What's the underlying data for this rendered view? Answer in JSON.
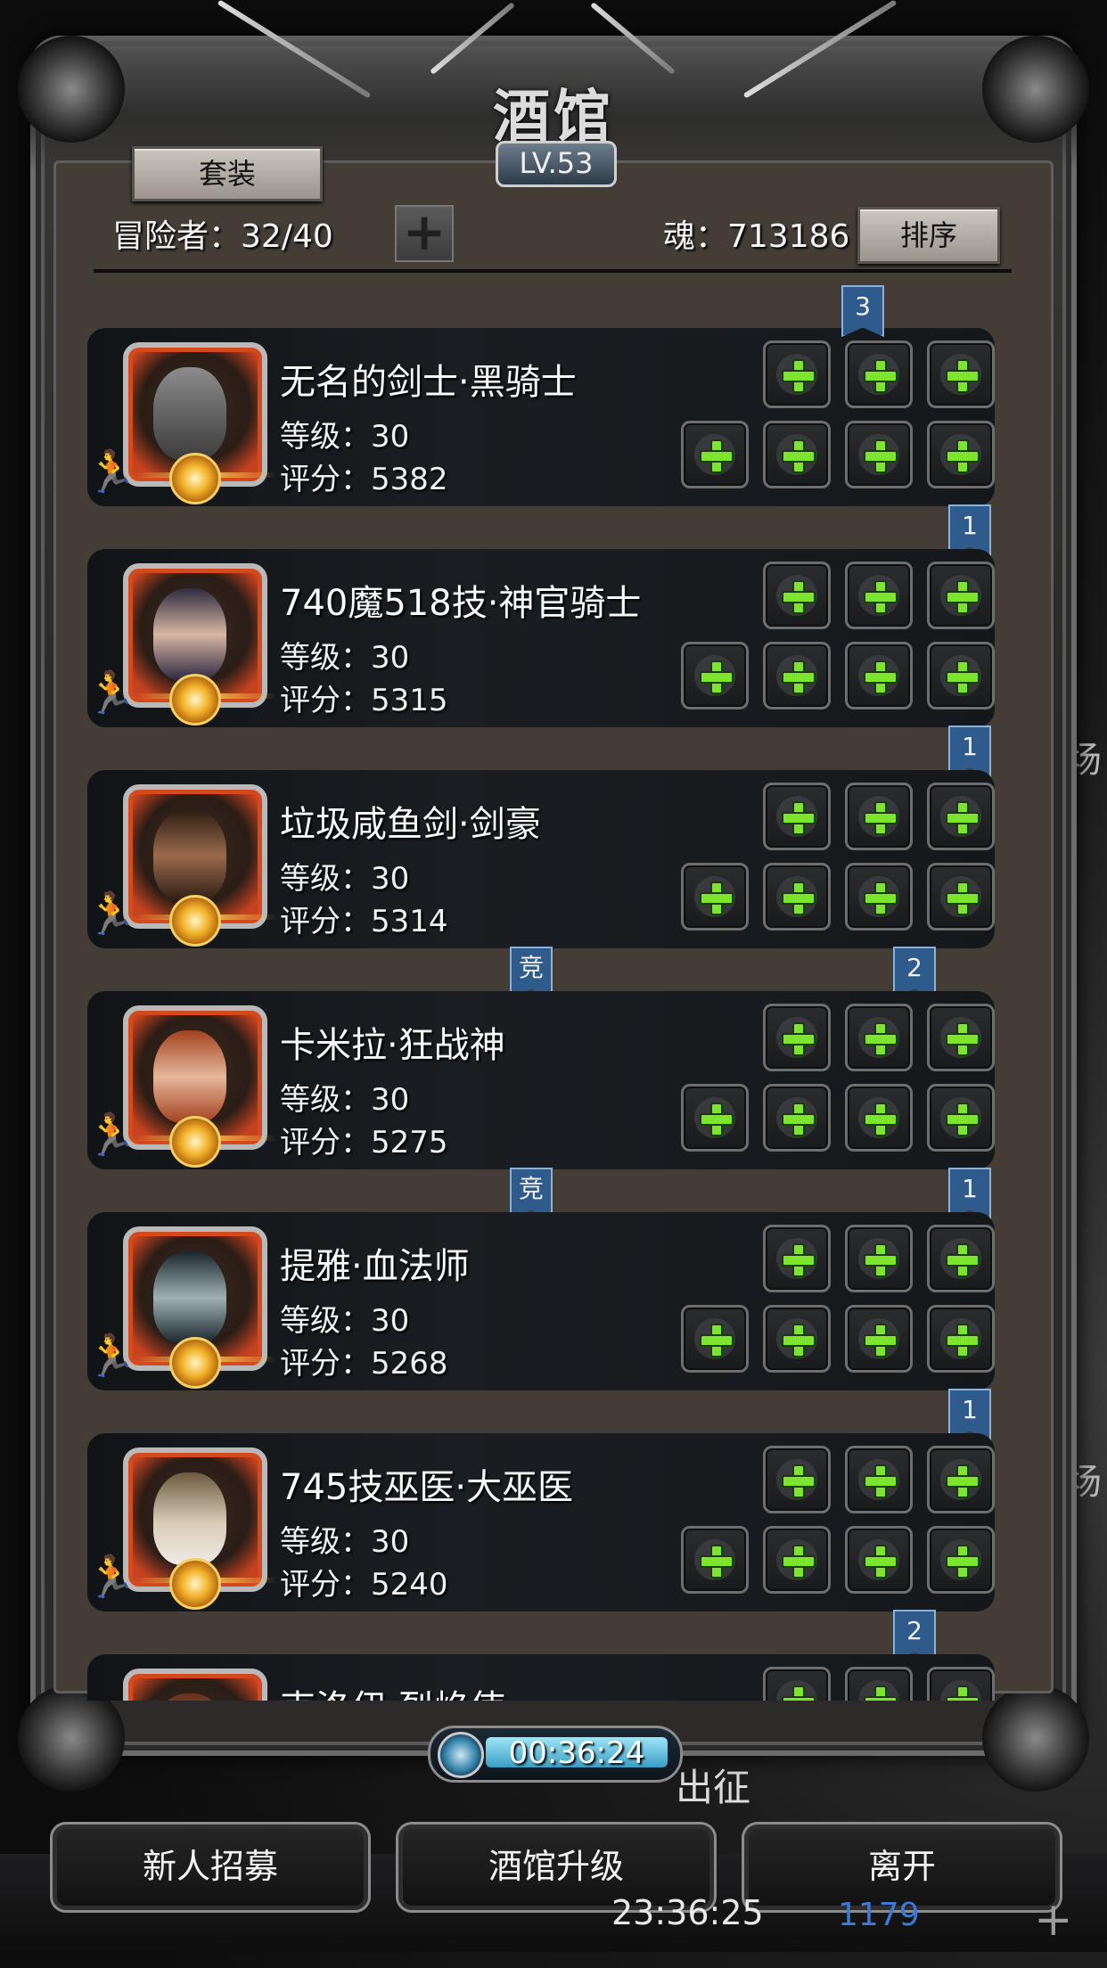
{
  "title": "酒馆",
  "level": "LV.53",
  "header": {
    "suit_button": "套装",
    "adventurers_label": "冒险者：32/40",
    "soul_label": "魂：713186",
    "sort_button": "排序"
  },
  "heroes": [
    {
      "name": "无名的剑士·黑骑士",
      "level": "等级：30",
      "score": "评分：5382",
      "ribbon_right": "3",
      "ribbon_left": ""
    },
    {
      "name": "740魔518技·神官骑士",
      "level": "等级：30",
      "score": "评分：5315",
      "ribbon_right": "1",
      "ribbon_left": ""
    },
    {
      "name": "垃圾咸鱼剑·剑豪",
      "level": "等级：30",
      "score": "评分：5314",
      "ribbon_right": "1",
      "ribbon_left": ""
    },
    {
      "name": "卡米拉·狂战神",
      "level": "等级：30",
      "score": "评分：5275",
      "ribbon_right": "2",
      "ribbon_left": "竞"
    },
    {
      "name": "提雅·血法师",
      "level": "等级：30",
      "score": "评分：5268",
      "ribbon_right": "1",
      "ribbon_left": "竞"
    },
    {
      "name": "745技巫医·大巫医",
      "level": "等级：30",
      "score": "评分：5240",
      "ribbon_right": "1",
      "ribbon_left": ""
    },
    {
      "name": "克洛伊·烈焰使",
      "level": "",
      "score": "",
      "ribbon_right": "2",
      "ribbon_left": ""
    }
  ],
  "timer": "00:36:24",
  "buttons": {
    "recruit": "新人招募",
    "upgrade": "酒馆升级",
    "leave": "离开"
  },
  "background": {
    "clock": "23:36:25",
    "coins": "1179",
    "label": "出征",
    "side": "场"
  },
  "colors": {
    "slot_plus": "#7ee52e",
    "ribbon": "#2f5a8c",
    "portrait_border": "#d44a1c"
  }
}
